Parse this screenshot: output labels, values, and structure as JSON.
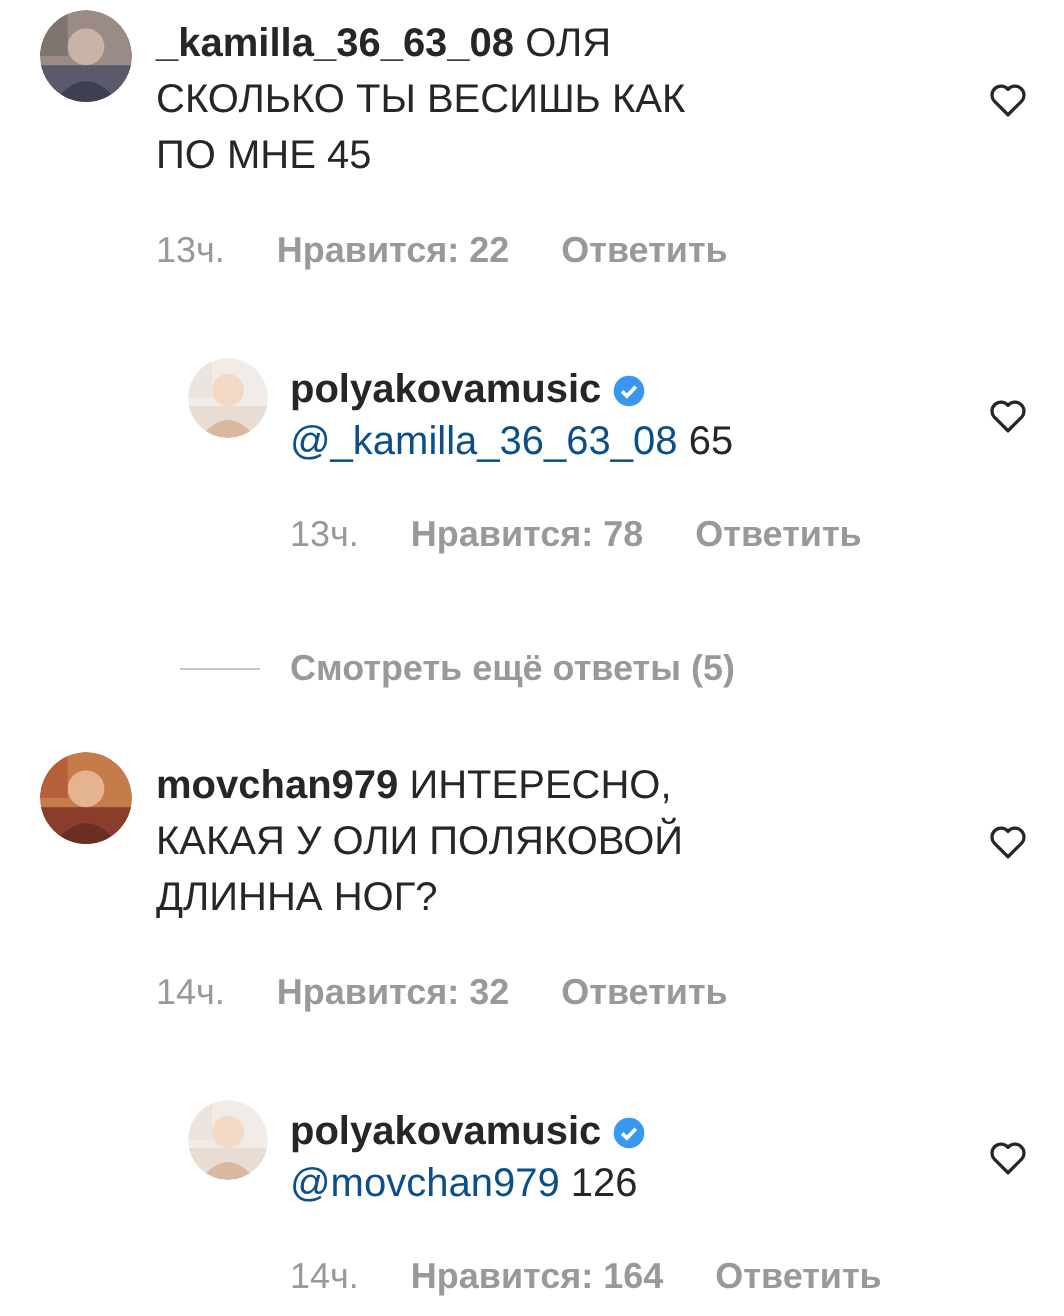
{
  "comments": [
    {
      "username": "_kamilla_36_63_08",
      "text_lines": [
        "ОЛЯ",
        "СКОЛЬКО ТЫ ВЕСИШЬ КАК",
        "ПО МНЕ 45"
      ],
      "time": "13ч.",
      "likes": "Нравится: 22",
      "reply_label": "Ответить",
      "liked": false,
      "replies": [
        {
          "username": "polyakovamusic",
          "verified": true,
          "mention": "@_kamilla_36_63_08",
          "text": "65",
          "time": "13ч.",
          "likes": "Нравится: 78",
          "reply_label": "Ответить",
          "liked": false
        }
      ],
      "view_more": "Смотреть ещё ответы (5)"
    },
    {
      "username": "movchan979",
      "text_lines": [
        "ИНТЕРЕСНО,",
        "КАКАЯ У ОЛИ ПОЛЯКОВОЙ",
        "ДЛИННА НОГ?"
      ],
      "time": "14ч.",
      "likes": "Нравится: 32",
      "reply_label": "Ответить",
      "liked": false,
      "replies": [
        {
          "username": "polyakovamusic",
          "verified": true,
          "mention": "@movchan979",
          "text": "126",
          "time": "14ч.",
          "likes": "Нравится: 164",
          "reply_label": "Ответить",
          "liked": false
        }
      ]
    }
  ]
}
